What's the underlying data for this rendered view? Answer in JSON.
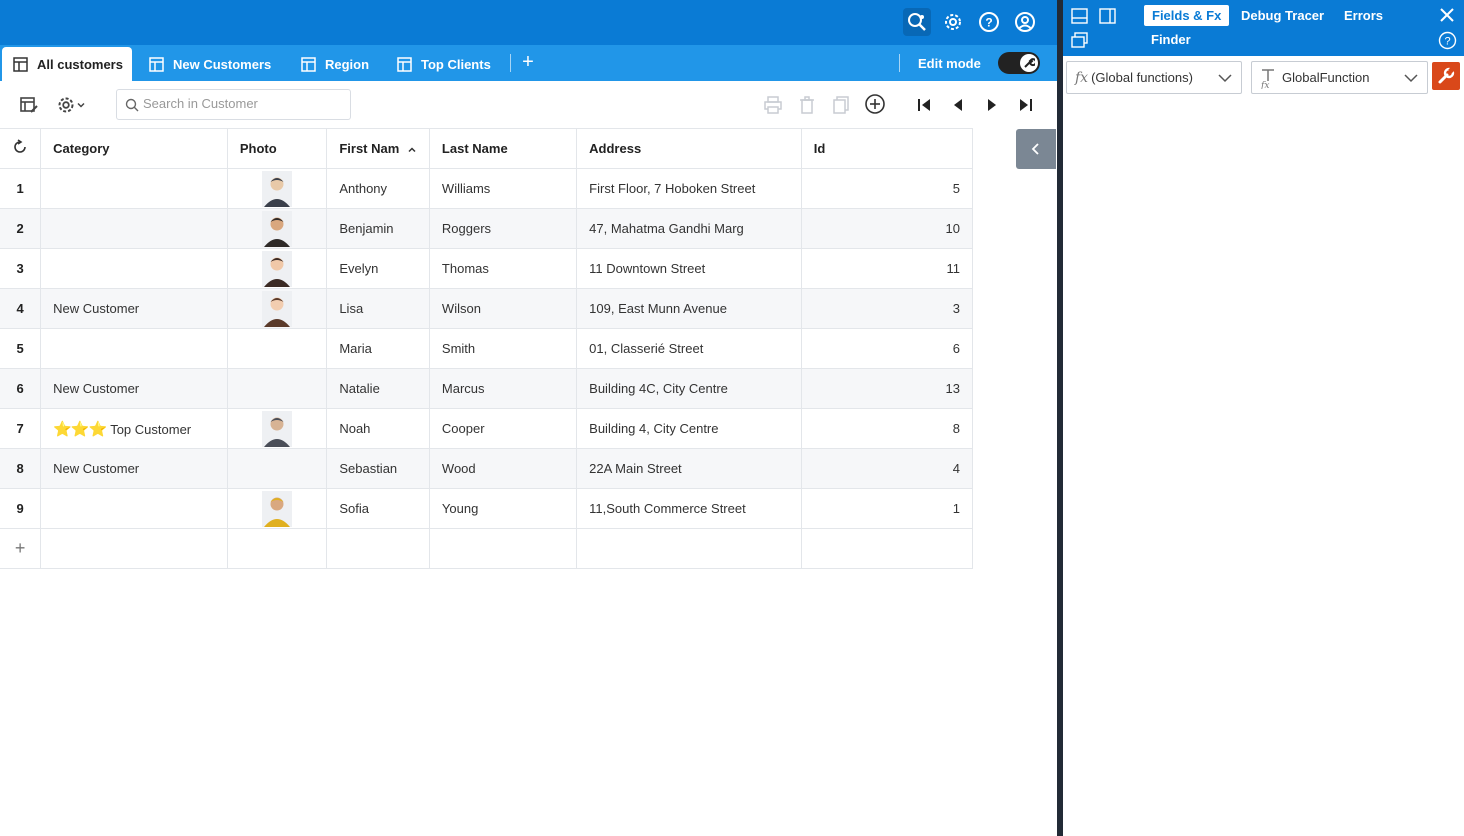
{
  "tabs": [
    {
      "label": "All customers",
      "active": true
    },
    {
      "label": "New Customers",
      "active": false
    },
    {
      "label": "Region",
      "active": false
    },
    {
      "label": "Top Clients",
      "active": false
    }
  ],
  "edit_mode_label": "Edit mode",
  "edit_mode_on": true,
  "search": {
    "placeholder": "Search in Customer"
  },
  "grid": {
    "columns": [
      "Category",
      "Photo",
      "First Nam",
      "Last Name",
      "Address",
      "Id"
    ],
    "sort_column": "First Nam",
    "rows": [
      {
        "n": "1",
        "category": "",
        "photo": true,
        "first": "Anthony",
        "last": "Williams",
        "address": "First Floor, 7 Hoboken Street",
        "id": "5"
      },
      {
        "n": "2",
        "category": "",
        "photo": true,
        "first": "Benjamin",
        "last": "Roggers",
        "address": "47, Mahatma Gandhi Marg",
        "id": "10"
      },
      {
        "n": "3",
        "category": "",
        "photo": true,
        "first": "Evelyn",
        "last": "Thomas",
        "address": "11 Downtown Street",
        "id": "11"
      },
      {
        "n": "4",
        "category": "New Customer",
        "photo": true,
        "first": "Lisa",
        "last": "Wilson",
        "address": "109, East Munn Avenue",
        "id": "3"
      },
      {
        "n": "5",
        "category": "",
        "photo": false,
        "first": "Maria",
        "last": "Smith",
        "address": "01, Classerié Street",
        "id": "6"
      },
      {
        "n": "6",
        "category": "New Customer",
        "photo": false,
        "first": "Natalie",
        "last": "Marcus",
        "address": "Building 4C, City Centre",
        "id": "13"
      },
      {
        "n": "7",
        "category": "Top Customer",
        "stars": 3,
        "photo": true,
        "first": "Noah",
        "last": "Cooper",
        "address": "Building 4, City Centre",
        "id": "8"
      },
      {
        "n": "8",
        "category": "New Customer",
        "photo": false,
        "first": "Sebastian",
        "last": "Wood",
        "address": "22A Main Street",
        "id": "4"
      },
      {
        "n": "9",
        "category": "",
        "photo": true,
        "first": "Sofia",
        "last": "Young",
        "address": "11,South Commerce Street",
        "id": "1"
      }
    ]
  },
  "panel": {
    "tabs": [
      "Fields & Fx",
      "Debug Tracer",
      "Errors",
      "Finder"
    ],
    "active_tab": "Fields & Fx",
    "select_scope": "(Global functions)",
    "select_function": "GlobalFunction"
  },
  "colors": {
    "header_blue": "#0a7bd5",
    "tab_blue": "#2196e8",
    "wrench_orange": "#d9481a"
  }
}
